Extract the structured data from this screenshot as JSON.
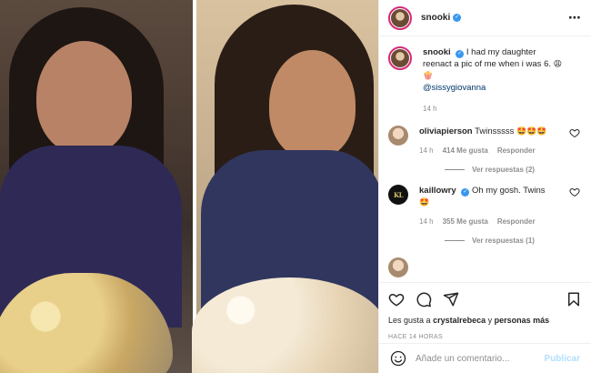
{
  "post": {
    "author": "snooki",
    "verified": true,
    "more_icon": "⋯",
    "caption": {
      "text": "I had my daughter reenact a pic of me when i was 6.",
      "emojis": "😩🍿",
      "mention": "@sissygiovanna"
    },
    "time_ago": "14 h"
  },
  "comments": [
    {
      "username": "oliviapierson",
      "verified": false,
      "text": "Twinsssss",
      "emojis": "🤩🤩🤩",
      "time": "14 h",
      "likes": "414 Me gusta",
      "reply_label": "Responder",
      "replies_label": "Ver respuestas (2)"
    },
    {
      "username": "kaillowry",
      "verified": true,
      "avatar_text": "KL",
      "text": "Oh my gosh. Twins",
      "emojis": "🤩",
      "time": "14 h",
      "likes": "355 Me gusta",
      "reply_label": "Responder",
      "replies_label": "Ver respuestas (1)"
    }
  ],
  "likes_line": {
    "prefix": "Les gusta a",
    "user": "crystalrebeca",
    "conjunction": "y",
    "others": "personas más"
  },
  "posted_ago": "HACE 14 HORAS",
  "composer": {
    "placeholder": "Añade un comentario...",
    "publish_label": "Publicar"
  },
  "icons": {
    "like": "heart-icon",
    "comment": "comment-icon",
    "share": "share-icon",
    "save": "bookmark-icon",
    "emoji": "smiley-icon",
    "more": "more-icon"
  },
  "colors": {
    "verified": "#3897f0",
    "link": "#00376b",
    "muted": "#8e8e8e",
    "publish_disabled": "#b2dffc"
  }
}
